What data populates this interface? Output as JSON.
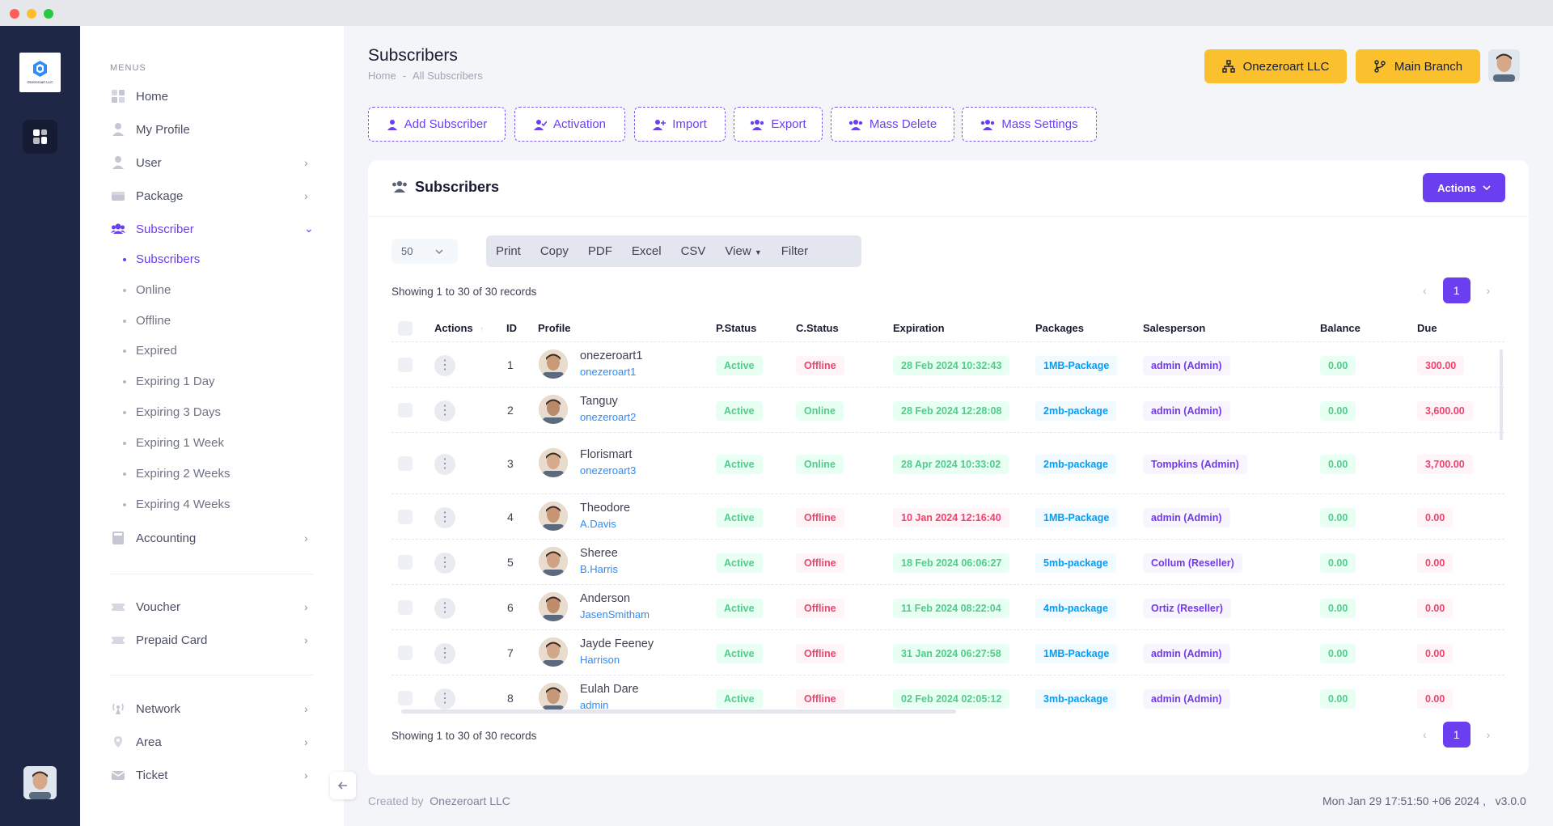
{
  "window": {
    "dots": [
      "#ff5f57",
      "#febc2e",
      "#28c840"
    ]
  },
  "sidebar": {
    "logo_text": "Onezeroart LLC",
    "menus_heading": "MENUS",
    "items": [
      {
        "label": "Home",
        "icon": "home-icon"
      },
      {
        "label": "My Profile",
        "icon": "user-icon"
      },
      {
        "label": "User",
        "icon": "user-icon"
      },
      {
        "label": "Package",
        "icon": "package-icon"
      },
      {
        "label": "Subscriber",
        "icon": "users-icon"
      },
      {
        "label": "Accounting",
        "icon": "calculator-icon"
      },
      {
        "label": "Voucher",
        "icon": "voucher-icon"
      },
      {
        "label": "Prepaid Card",
        "icon": "card-icon"
      },
      {
        "label": "Network",
        "icon": "antenna-icon"
      },
      {
        "label": "Area",
        "icon": "pin-icon"
      },
      {
        "label": "Ticket",
        "icon": "ticket-icon"
      }
    ],
    "sub_items": [
      "Subscribers",
      "Online",
      "Offline",
      "Expired",
      "Expiring 1 Day",
      "Expiring 3 Days",
      "Expiring 1 Week",
      "Expiring 2 Weeks",
      "Expiring 4 Weeks"
    ]
  },
  "header": {
    "title": "Subscribers",
    "breadcrumb": [
      "Home",
      "-",
      "All Subscribers"
    ],
    "company_button": "Onezeroart LLC",
    "branch_button": "Main Branch"
  },
  "toolbar": [
    "Add Subscriber",
    "Activation",
    "Import",
    "Export",
    "Mass Delete",
    "Mass Settings"
  ],
  "card": {
    "title": "Subscribers",
    "actions_label": "Actions",
    "page_length": "50",
    "tools": [
      "Print",
      "Copy",
      "PDF",
      "Excel",
      "CSV",
      "View",
      "Filter"
    ],
    "showing": "Showing 1 to 30 of 30 records",
    "current_page": "1"
  },
  "table": {
    "columns": [
      "Actions",
      "ID",
      "Profile",
      "P.Status",
      "C.Status",
      "Expiration",
      "Packages",
      "Salesperson",
      "Balance",
      "Due"
    ],
    "rows": [
      {
        "id": "1",
        "name": "onezeroart1",
        "username": "onezeroart1",
        "pstatus": "Active",
        "cstatus": "Offline",
        "expiration": "28 Feb 2024 10:32:43",
        "exp_state": "ok",
        "package": "1MB-Package",
        "salesperson": "admin (Admin)",
        "balance": "0.00",
        "due": "300.00"
      },
      {
        "id": "2",
        "name": "Tanguy",
        "username": "onezeroart2",
        "pstatus": "Active",
        "cstatus": "Online",
        "expiration": "28 Feb 2024 12:28:08",
        "exp_state": "ok",
        "package": "2mb-package",
        "salesperson": "admin (Admin)",
        "balance": "0.00",
        "due": "3,600.00"
      },
      {
        "id": "3",
        "name": "Florismart",
        "username": "onezeroart3",
        "pstatus": "Active",
        "cstatus": "Online",
        "expiration": "28 Apr 2024 10:33:02",
        "exp_state": "ok",
        "package": "2mb-package",
        "salesperson": "Tompkins (Admin)",
        "balance": "0.00",
        "due": "3,700.00"
      },
      {
        "id": "4",
        "name": "Theodore",
        "username": "A.Davis",
        "pstatus": "Active",
        "cstatus": "Offline",
        "expiration": "10 Jan 2024 12:16:40",
        "exp_state": "expired",
        "package": "1MB-Package",
        "salesperson": "admin (Admin)",
        "balance": "0.00",
        "due": "0.00"
      },
      {
        "id": "5",
        "name": "Sheree",
        "username": "B.Harris",
        "pstatus": "Active",
        "cstatus": "Offline",
        "expiration": "18 Feb 2024 06:06:27",
        "exp_state": "ok",
        "package": "5mb-package",
        "salesperson": "Collum (Reseller)",
        "balance": "0.00",
        "due": "0.00"
      },
      {
        "id": "6",
        "name": "Anderson",
        "username": "JasenSmitham",
        "pstatus": "Active",
        "cstatus": "Offline",
        "expiration": "11 Feb 2024 08:22:04",
        "exp_state": "ok",
        "package": "4mb-package",
        "salesperson": "Ortiz (Reseller)",
        "balance": "0.00",
        "due": "0.00"
      },
      {
        "id": "7",
        "name": "Jayde Feeney",
        "username": "Harrison",
        "pstatus": "Active",
        "cstatus": "Offline",
        "expiration": "31 Jan 2024 06:27:58",
        "exp_state": "ok",
        "package": "1MB-Package",
        "salesperson": "admin (Admin)",
        "balance": "0.00",
        "due": "0.00"
      },
      {
        "id": "8",
        "name": "Eulah Dare",
        "username": "admin",
        "pstatus": "Active",
        "cstatus": "Offline",
        "expiration": "02 Feb 2024 02:05:12",
        "exp_state": "ok",
        "package": "3mb-package",
        "salesperson": "admin (Admin)",
        "balance": "0.00",
        "due": "0.00"
      }
    ]
  },
  "footer": {
    "created_by": "Created by",
    "company": "Onezeroart LLC",
    "datetime": "Mon Jan 29 17:51:50 +06 2024 ,",
    "version": "v3.0.0"
  },
  "colors": {
    "accent": "#6b3ff0",
    "yellow": "#fbc02d",
    "rail": "#1e2746"
  }
}
